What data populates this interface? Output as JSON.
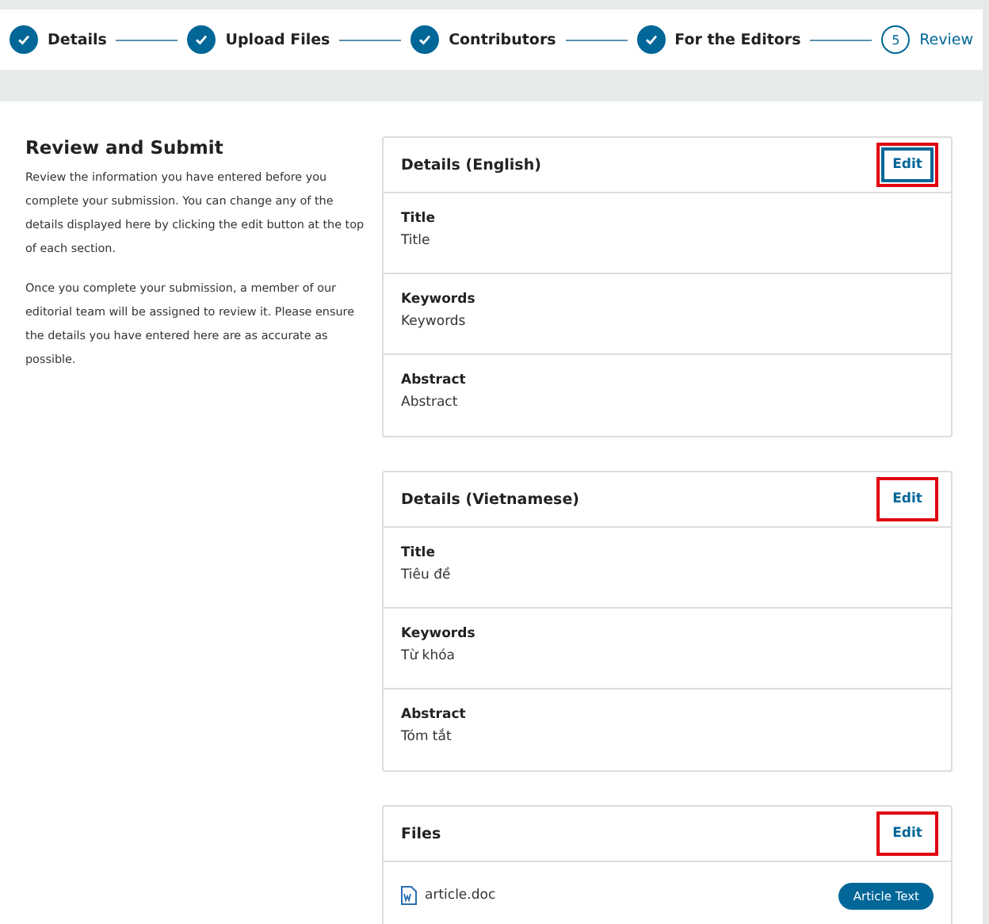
{
  "steps": [
    {
      "label": "Details",
      "completed": true,
      "selected": false
    },
    {
      "label": "Upload Files",
      "completed": true,
      "selected": false
    },
    {
      "label": "Contributors",
      "completed": true,
      "selected": false
    },
    {
      "label": "For the Editors",
      "completed": true,
      "selected": false
    },
    {
      "label": "Review",
      "number": "5",
      "completed": false,
      "selected": true
    }
  ],
  "intro": {
    "heading": "Review and Submit",
    "paragraphs": [
      "Review the information you have entered before you complete your submission. You can change any of the details displayed here by clicking the edit button at the top of each section.",
      "Once you complete your submission, a member of our editorial team will be assigned to review it. Please ensure the details you have entered here are as accurate as possible."
    ]
  },
  "sections": [
    {
      "title": "Details (English)",
      "edit": {
        "label": "Edit",
        "highlighted": true,
        "focused": true
      },
      "fields": [
        {
          "label": "Title",
          "value": "Title"
        },
        {
          "label": "Keywords",
          "value": "Keywords"
        },
        {
          "label": "Abstract",
          "value": "Abstract"
        }
      ]
    },
    {
      "title": "Details (Vietnamese)",
      "edit": {
        "label": "Edit",
        "highlighted": true,
        "focused": false
      },
      "fields": [
        {
          "label": "Title",
          "value": "Tiêu đề"
        },
        {
          "label": "Keywords",
          "value": "Từ khóa"
        },
        {
          "label": "Abstract",
          "value": "Tóm tắt"
        }
      ]
    },
    {
      "title": "Files",
      "edit": {
        "label": "Edit",
        "highlighted": true,
        "focused": false
      },
      "files": [
        {
          "name": "article.doc",
          "type": "Article Text"
        }
      ]
    }
  ]
}
